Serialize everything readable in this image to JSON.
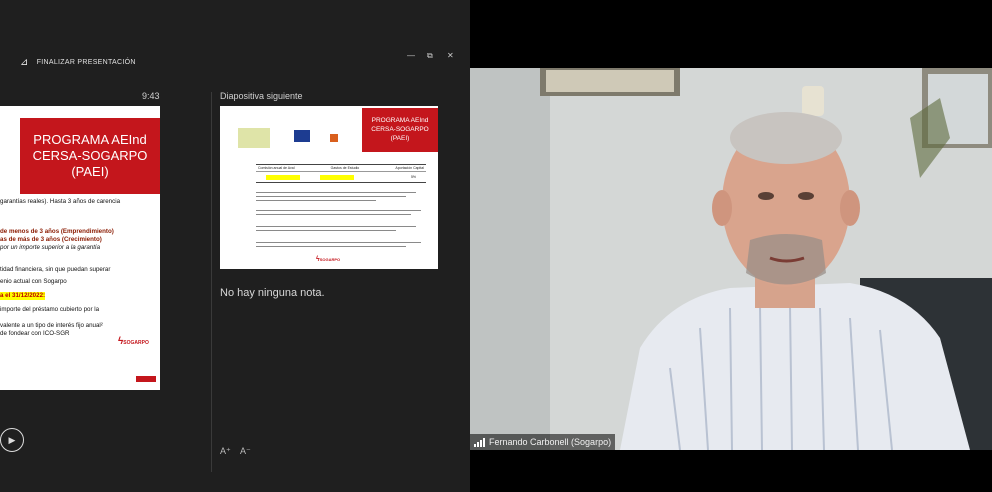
{
  "presenter": {
    "finalize_label": "FINALIZAR PRESENTACIÓN",
    "window_controls": {
      "minimize": "—",
      "maximize": "⧉",
      "close": "✕"
    },
    "clock": "9:43",
    "next_slide_label": "Diapositiva siguiente",
    "notes_text": "No hay ninguna nota.",
    "font_increase": "A⁺",
    "font_decrease": "A⁻"
  },
  "current_slide": {
    "title": "PROGRAMA AEInd CERSA-SOGARPO (PAEI)",
    "lines": [
      "garantías reales). Hasta 3 años de carencia",
      "de menos de 3 años (Emprendimiento)",
      "as de más de 3 años (Crecimiento)",
      "por un importe superior a la garantía",
      "tidad financiera, sin que puedan superar",
      "enio actual con Sogarpo",
      "a el 31/12/2022:",
      "importe del préstamo cubierto por la",
      "valente a un tipo de interés fijo anual²",
      "de fondear con ICO-SGR"
    ],
    "logo_text": "SOGARPO"
  },
  "next_slide": {
    "title": "PROGRAMA AEInd CERSA-SOGARPO (PAEI)",
    "table_headers": [
      "Comisión anual de Aval",
      "Gastos de Estudio",
      "Aportación Capital"
    ],
    "table_values": [
      "1,00%",
      "0,50%",
      "5%"
    ],
    "logo_text": "SOGARPO"
  },
  "video": {
    "participant_name": "Fernando Carbonell (Sogarpo)"
  },
  "colors": {
    "brand_red": "#c4161c",
    "highlight_yellow": "#ffff00"
  }
}
